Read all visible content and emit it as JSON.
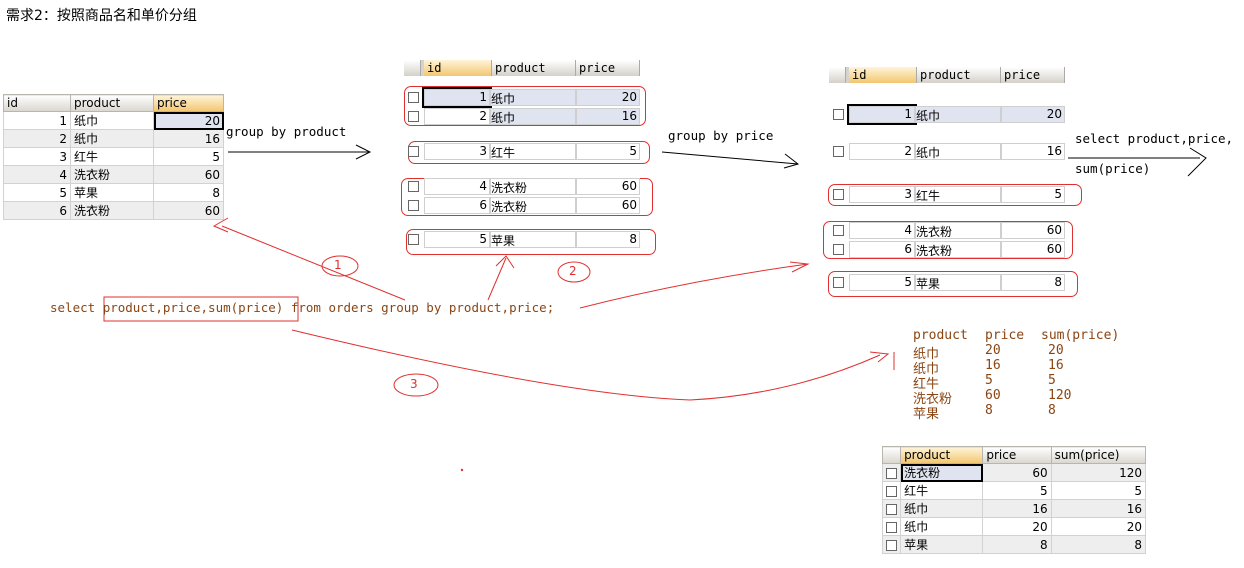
{
  "title": "需求2：按照商品名和单价分组",
  "columns": {
    "id": "id",
    "product": "product",
    "price": "price",
    "sum": "sum(price)"
  },
  "source_table": {
    "rows": [
      {
        "id": "1",
        "product": "纸巾",
        "price": "20"
      },
      {
        "id": "2",
        "product": "纸巾",
        "price": "16"
      },
      {
        "id": "3",
        "product": "红牛",
        "price": "5"
      },
      {
        "id": "4",
        "product": "洗衣粉",
        "price": "60"
      },
      {
        "id": "5",
        "product": "苹果",
        "price": "8"
      },
      {
        "id": "6",
        "product": "洗衣粉",
        "price": "60"
      }
    ]
  },
  "labels": {
    "group_by_product": "group by product",
    "group_by_price": "group by price",
    "select_product_price": "select product,price,",
    "sum_price": "sum(price)"
  },
  "group_by_product": {
    "groups": [
      [
        {
          "id": "1",
          "product": "纸巾",
          "price": "20"
        },
        {
          "id": "2",
          "product": "纸巾",
          "price": "16"
        }
      ],
      [
        {
          "id": "3",
          "product": "红牛",
          "price": "5"
        }
      ],
      [
        {
          "id": "4",
          "product": "洗衣粉",
          "price": "60"
        },
        {
          "id": "6",
          "product": "洗衣粉",
          "price": "60"
        }
      ],
      [
        {
          "id": "5",
          "product": "苹果",
          "price": "8"
        }
      ]
    ]
  },
  "group_by_price": {
    "groups": [
      [
        {
          "id": "1",
          "product": "纸巾",
          "price": "20"
        }
      ],
      [
        {
          "id": "2",
          "product": "纸巾",
          "price": "16"
        }
      ],
      [
        {
          "id": "3",
          "product": "红牛",
          "price": "5"
        }
      ],
      [
        {
          "id": "4",
          "product": "洗衣粉",
          "price": "60"
        },
        {
          "id": "6",
          "product": "洗衣粉",
          "price": "60"
        }
      ],
      [
        {
          "id": "5",
          "product": "苹果",
          "price": "8"
        }
      ]
    ]
  },
  "sql": {
    "prefix": "select ",
    "boxed": "product,price,sum(price)",
    "suffix": " from orders group by product,price;"
  },
  "annotations": [
    "1",
    "2",
    "3"
  ],
  "text_result": {
    "header": [
      "product",
      "price",
      "sum(price)"
    ],
    "rows": [
      [
        "纸巾",
        "20",
        "20"
      ],
      [
        "纸巾",
        "16",
        "16"
      ],
      [
        "红牛",
        "5",
        "5"
      ],
      [
        "洗衣粉",
        "60",
        "120"
      ],
      [
        "苹果",
        "8",
        "8"
      ]
    ]
  },
  "result_table": {
    "rows": [
      {
        "product": "洗衣粉",
        "price": "60",
        "sum": "120"
      },
      {
        "product": "红牛",
        "price": "5",
        "sum": "5"
      },
      {
        "product": "纸巾",
        "price": "16",
        "sum": "16"
      },
      {
        "product": "纸巾",
        "price": "20",
        "sum": "20"
      },
      {
        "product": "苹果",
        "price": "8",
        "sum": "8"
      }
    ]
  },
  "colors": {
    "annotation_red": "#e03030",
    "sql_brown": "#8b4513"
  }
}
